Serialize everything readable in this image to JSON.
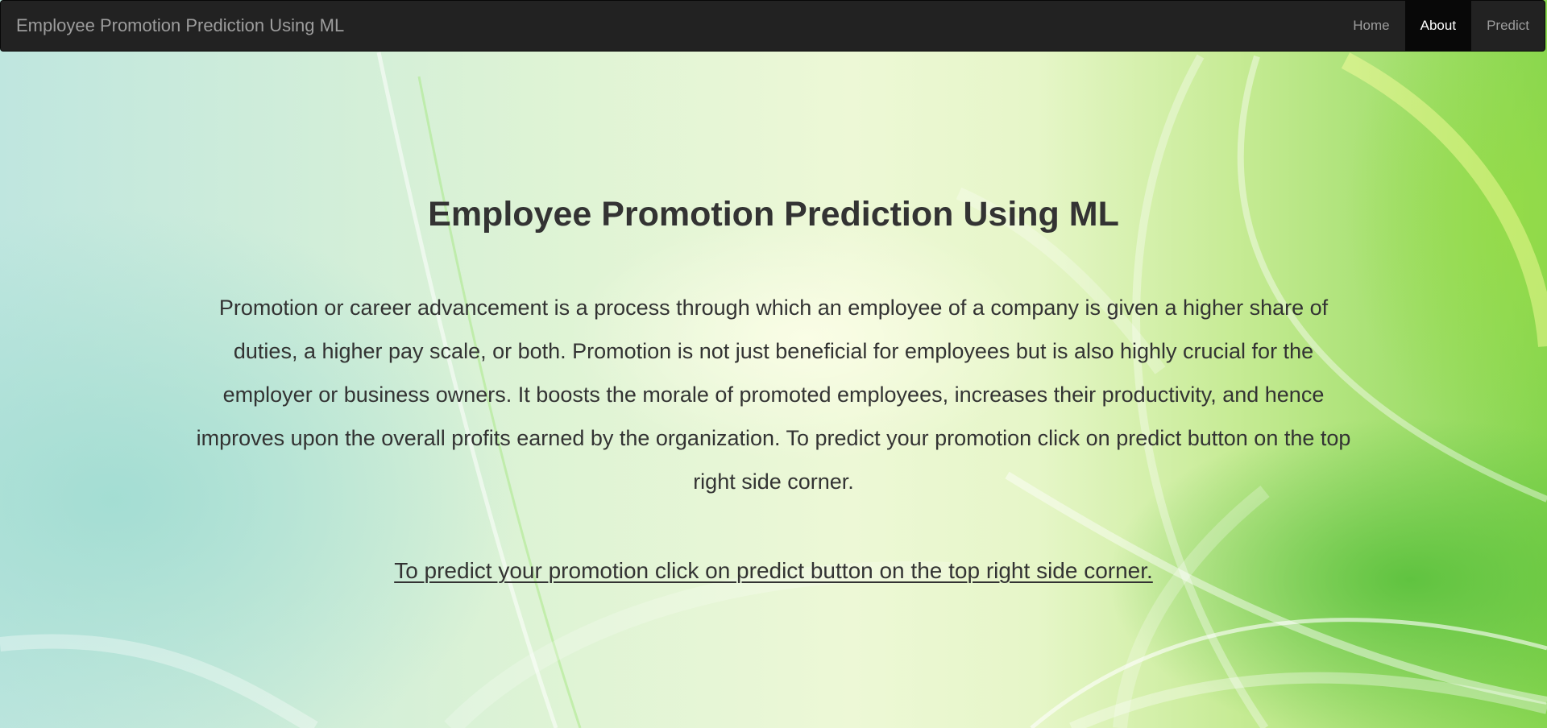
{
  "navbar": {
    "brand": "Employee Promotion Prediction Using ML",
    "links": [
      {
        "label": "Home",
        "active": false
      },
      {
        "label": "About",
        "active": true
      },
      {
        "label": "Predict",
        "active": false
      }
    ]
  },
  "main": {
    "title": "Employee Promotion Prediction Using ML",
    "description": "Promotion or career advancement is a process through which an employee of a company is given a higher share of duties, a higher pay scale, or both. Promotion is not just beneficial for employees but is also highly crucial for the employer or business owners. It boosts the morale of promoted employees, increases their productivity, and hence improves upon the overall profits earned by the organization. To predict your promotion click on predict button on the top right side corner.",
    "link_text": "To predict your promotion click on predict button on the top right side corner."
  },
  "colors": {
    "navbar_background": "#222222",
    "active_nav_background": "#080808",
    "text": "#333333",
    "background_green": "#86d54f",
    "background_aqua": "#bfe6df"
  }
}
